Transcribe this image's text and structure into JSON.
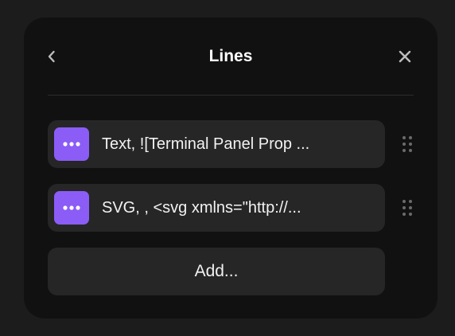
{
  "header": {
    "title": "Lines",
    "back_icon": "chevron-left-icon",
    "close_icon": "close-icon"
  },
  "lines": {
    "items": [
      {
        "label": "Text, ![Terminal Panel Prop ...",
        "icon": "more-horizontal-icon"
      },
      {
        "label": "SVG, , <svg xmlns=\"http://...",
        "icon": "more-horizontal-icon"
      }
    ],
    "drag_icon": "drag-handle-icon"
  },
  "add_button": {
    "label": "Add..."
  },
  "colors": {
    "background": "#1c1c1c",
    "panel": "#111111",
    "row": "#262626",
    "accent": "#8b5cf6",
    "text": "#f2f2f2"
  }
}
